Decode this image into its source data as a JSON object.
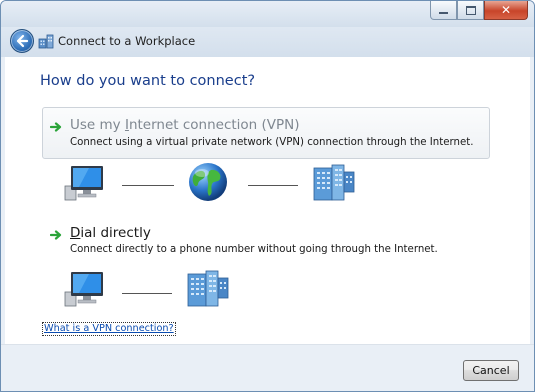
{
  "window": {
    "title": "Connect to a Workplace",
    "controls": {
      "minimize": "minimize",
      "maximize": "maximize",
      "close": "close"
    }
  },
  "page": {
    "heading": "How do you want to connect?"
  },
  "options": [
    {
      "title": "Use my Internet connection (VPN)",
      "mnemonic": "I",
      "description": "Connect using a virtual private network (VPN) connection through the Internet.",
      "diagram": [
        "computer-icon",
        "globe-icon",
        "server-icon"
      ]
    },
    {
      "title": "Dial directly",
      "mnemonic": "D",
      "description": "Connect directly to a phone number without going through the Internet.",
      "diagram": [
        "computer-icon",
        "server-icon"
      ]
    }
  ],
  "help_link": "What is a VPN connection?",
  "footer": {
    "cancel_label": "Cancel"
  },
  "colors": {
    "heading": "#1a3e8c",
    "option_title_gray": "#7f8790",
    "link": "#0b4cb0",
    "arrow_green": "#2ca43a"
  }
}
